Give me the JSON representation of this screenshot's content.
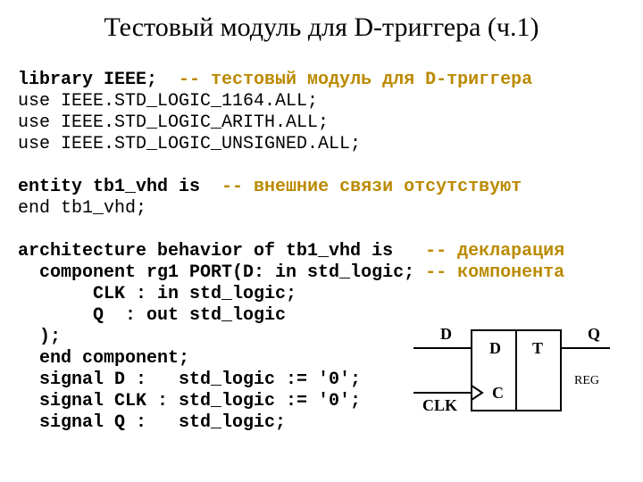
{
  "title": "Тестовый модуль для D-триггера (ч.1)",
  "code": {
    "l1a": "library IEEE;  ",
    "l1b": "-- тестовый модуль для D-триггера",
    "l2": "use IEEE.STD_LOGIC_1164.ALL;",
    "l3": "use IEEE.STD_LOGIC_ARITH.ALL;",
    "l4": "use IEEE.STD_LOGIC_UNSIGNED.ALL;",
    "blank1": " ",
    "l5a": "entity tb1_vhd is  ",
    "l5b": "-- внешние связи отсутствуют",
    "l6": "end tb1_vhd;",
    "blank2": " ",
    "l7a": "architecture behavior of tb1_vhd is   ",
    "l7b": "-- декларация",
    "l8a": "  component rg1 PORT(D: in std_logic; ",
    "l8b": "-- компонента",
    "l9": "       CLK : in std_logic;",
    "l10": "       Q  : out std_logic",
    "l11": "  );",
    "l12": "  end component;",
    "l13": "  signal D :   std_logic := '0';",
    "l14": "  signal CLK : std_logic := '0';",
    "l15": "  signal Q :   std_logic;"
  },
  "diagram": {
    "d_label": "D",
    "clk_label": "CLK",
    "q_label": "Q",
    "reg_label": "REG",
    "pin_d": "D",
    "pin_c": "C",
    "t_label": "T"
  }
}
